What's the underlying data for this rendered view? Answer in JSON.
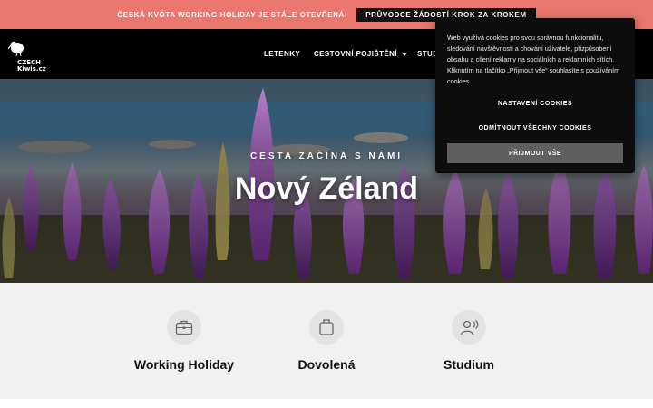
{
  "announcement": {
    "text": "Česká kvóta Working Holiday je stále otevřená:",
    "button_label": "Průvodce žádostí krok za krokem",
    "bg_color": "#e9776d"
  },
  "header": {
    "logo_line1": "CZECH",
    "logo_line2": "Kiwis.cz",
    "logo_icon": "kiwi-bird-icon",
    "nav": [
      {
        "label": "Letenky"
      },
      {
        "label": "Cestovní pojištění",
        "has_dropdown": true
      },
      {
        "label": "Stud"
      }
    ]
  },
  "hero": {
    "kicker": "Cesta začíná s námi",
    "title": "Nový Zéland"
  },
  "features": [
    {
      "label": "Working Holiday",
      "icon": "briefcase-icon"
    },
    {
      "label": "Dovolená",
      "icon": "suitcase-icon"
    },
    {
      "label": "Studium",
      "icon": "student-icon"
    }
  ],
  "cookie_banner": {
    "text": "Web využívá cookies pro svou správnou funkcionalitu, sledování návštěvnosti a chování uživatele, přizpůsobení obsahu a cílení reklamy na sociálních a reklamních sítích. Kliknutím na tlačítko „Přijmout vše“ souhlasíte s používáním cookies.",
    "settings_label": "Nastavení cookies",
    "reject_label": "Odmítnout všechny cookies",
    "accept_label": "Přijmout vše"
  }
}
